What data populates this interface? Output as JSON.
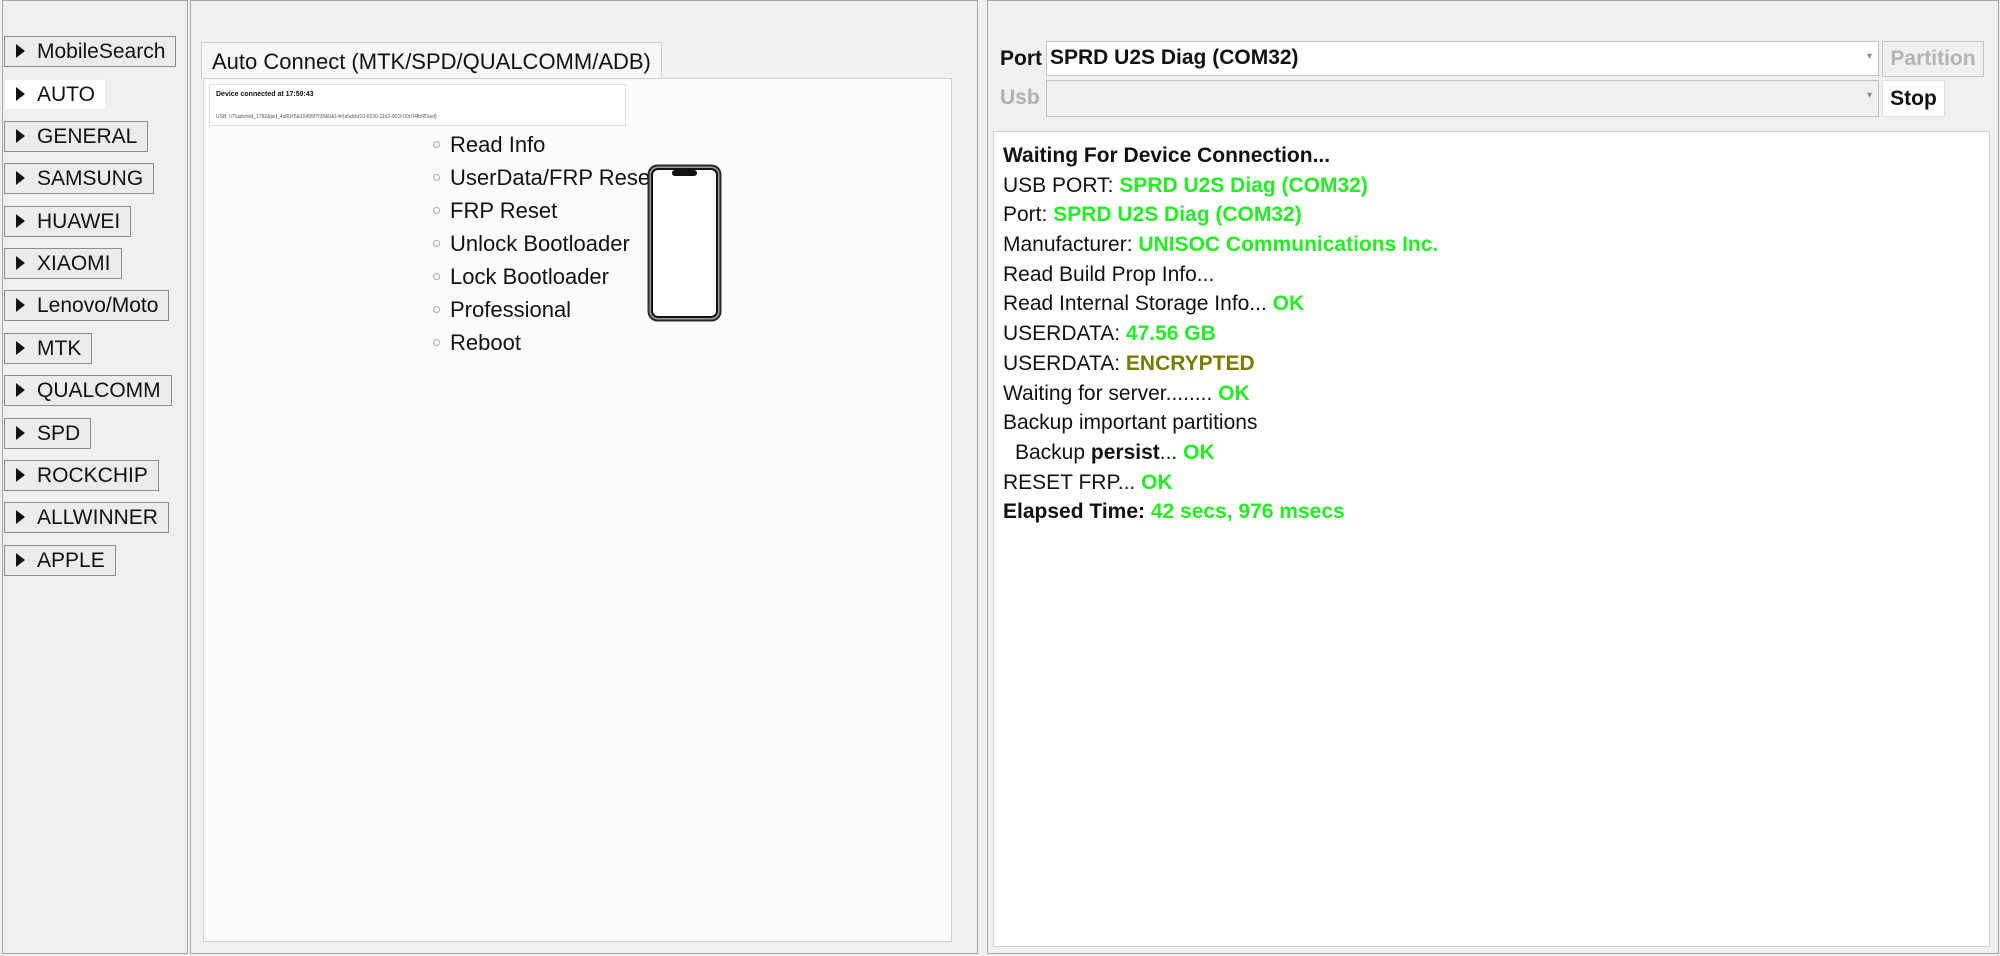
{
  "sidebar": {
    "items": [
      {
        "label": "MobileSearch"
      },
      {
        "label": "AUTO"
      },
      {
        "label": "GENERAL"
      },
      {
        "label": "SAMSUNG"
      },
      {
        "label": "HUAWEI"
      },
      {
        "label": "XIAOMI"
      },
      {
        "label": "Lenovo/Moto"
      },
      {
        "label": "MTK"
      },
      {
        "label": "QUALCOMM"
      },
      {
        "label": "SPD"
      },
      {
        "label": "ROCKCHIP"
      },
      {
        "label": "ALLWINNER"
      },
      {
        "label": "APPLE"
      }
    ],
    "active": "AUTO"
  },
  "main": {
    "tab_label": "Auto Connect (MTK/SPD/QUALCOMM/ADB)",
    "device": {
      "connected_text": "Device connected at 17:59:43",
      "usb_text": "USB: \\\\?\\usb#vid_1782&pid_4d00#5&15495f7f28&0&14#{a5dcbf10-6530-11d2-901f-00c04fb951ed}"
    },
    "actions": [
      "Read Info",
      "UserData/FRP Reset",
      "FRP Reset",
      "Unlock Bootloader",
      "Lock Bootloader",
      "Professional",
      "Reboot"
    ]
  },
  "port_panel": {
    "port_label": "Port",
    "port_value": "SPRD U2S Diag (COM32)",
    "usb_label": "Usb",
    "usb_value": "",
    "partition_button": "Partition",
    "stop_button": "Stop"
  },
  "log": {
    "l1": {
      "text": "Waiting For Device Connection..."
    },
    "l2": {
      "label": "USB PORT: ",
      "value": "SPRD U2S Diag (COM32)"
    },
    "l3": {
      "label": "Port: ",
      "value": "SPRD U2S Diag (COM32)"
    },
    "l4": {
      "label": "Manufacturer: ",
      "value": "UNISOC Communications Inc."
    },
    "l5": {
      "text": "Read Build Prop Info..."
    },
    "l6": {
      "label": "Read Internal Storage Info... ",
      "value": "OK"
    },
    "l7": {
      "label": "USERDATA: ",
      "value": "47.56 GB"
    },
    "l8": {
      "label": "USERDATA: ",
      "value": "ENCRYPTED"
    },
    "l9": {
      "label": "Waiting for server........ ",
      "value": "OK"
    },
    "l10": {
      "text": "Backup important partitions"
    },
    "l11": {
      "prefix": "Backup ",
      "name": "persist",
      "suffix": "... ",
      "value": "OK"
    },
    "l12": {
      "label": "RESET FRP... ",
      "value": "OK"
    },
    "l13": {
      "label": "Elapsed Time: ",
      "value": "42 secs, 976 msecs"
    }
  },
  "colors": {
    "success": "#22ee22",
    "warning": "#7a7a00",
    "panel_bg": "#f0f0f0"
  },
  "icons": {
    "sidebar_expander": "triangle-right-icon",
    "device_image": "smartphone-icon"
  }
}
